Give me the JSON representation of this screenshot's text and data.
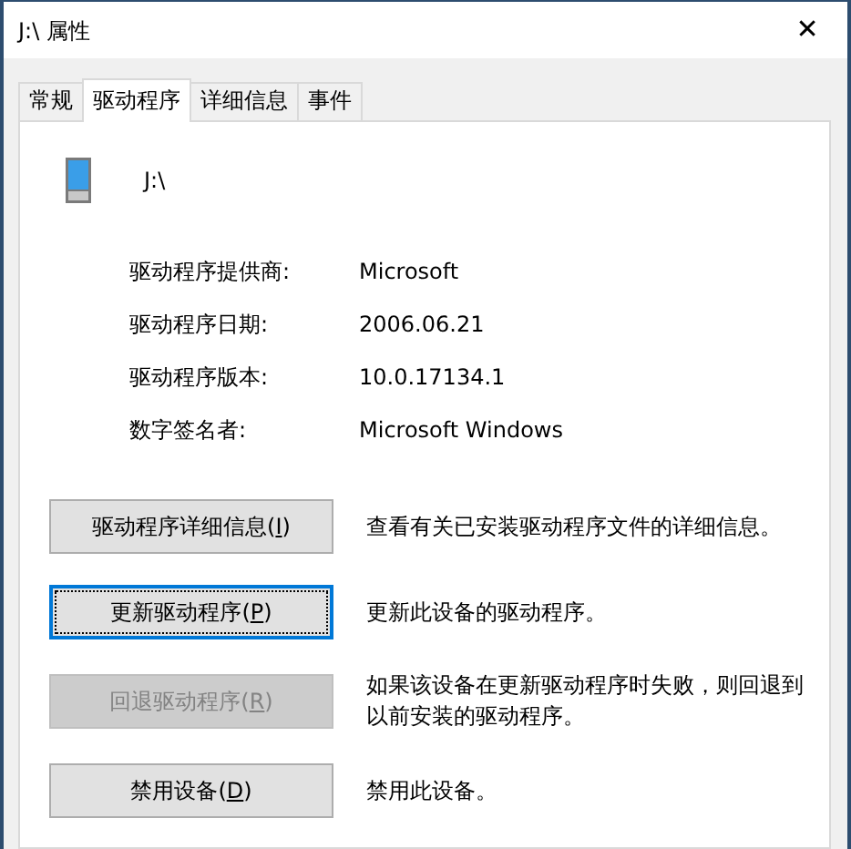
{
  "window": {
    "title": "J:\\ 属性",
    "close": "✕"
  },
  "tabs": [
    {
      "label": "常规",
      "selected": false
    },
    {
      "label": "驱动程序",
      "selected": true
    },
    {
      "label": "详细信息",
      "selected": false
    },
    {
      "label": "事件",
      "selected": false
    }
  ],
  "device": {
    "name": "J:\\"
  },
  "properties": [
    {
      "label": "驱动程序提供商:",
      "value": "Microsoft"
    },
    {
      "label": "驱动程序日期:",
      "value": "2006.06.21"
    },
    {
      "label": "驱动程序版本:",
      "value": "10.0.17134.1"
    },
    {
      "label": "数字签名者:",
      "value": "Microsoft Windows"
    }
  ],
  "actions": [
    {
      "text_before": "驱动程序详细信息(",
      "mnemonic": "I",
      "text_after": ")",
      "focused": false,
      "disabled": false,
      "description": "查看有关已安装驱动程序文件的详细信息。"
    },
    {
      "text_before": "更新驱动程序(",
      "mnemonic": "P",
      "text_after": ")",
      "focused": true,
      "disabled": false,
      "description": "更新此设备的驱动程序。"
    },
    {
      "text_before": "回退驱动程序(",
      "mnemonic": "R",
      "text_after": ")",
      "focused": false,
      "disabled": true,
      "description": "如果该设备在更新驱动程序时失败，则回退到以前安装的驱动程序。"
    },
    {
      "text_before": "禁用设备(",
      "mnemonic": "D",
      "text_after": ")",
      "focused": false,
      "disabled": false,
      "description": "禁用此设备。"
    }
  ]
}
